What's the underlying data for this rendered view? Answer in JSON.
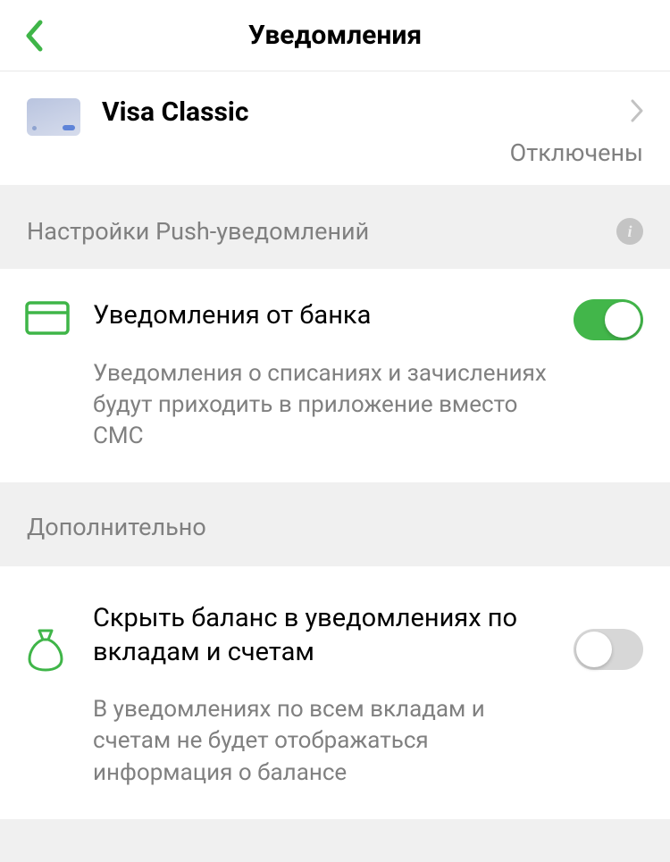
{
  "header": {
    "title": "Уведомления"
  },
  "card": {
    "name": "Visa Classic",
    "status": "Отключены"
  },
  "sections": {
    "push": {
      "title": "Настройки Push-уведомлений"
    },
    "extra": {
      "title": "Дополнительно"
    }
  },
  "settings": {
    "bankNotify": {
      "title": "Уведомления от банка",
      "desc": "Уведомления о списаниях и зачислениях будут приходить в приложение вместо СМС",
      "on": true
    },
    "hideBalance": {
      "title": "Скрыть баланс в уведомлениях по вкладам и счетам",
      "desc": "В уведомлениях по всем вкладам и счетам не будет отображаться информация о балансе",
      "on": false
    }
  }
}
